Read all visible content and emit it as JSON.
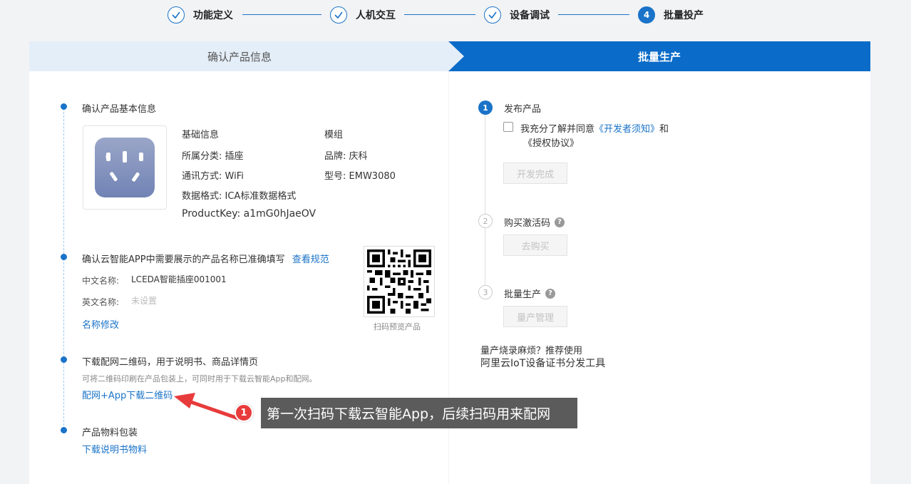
{
  "stepper": {
    "steps": [
      {
        "label": "功能定义",
        "state": "done"
      },
      {
        "label": "人机交互",
        "state": "done"
      },
      {
        "label": "设备调试",
        "state": "done"
      },
      {
        "label": "批量投产",
        "state": "active",
        "number": "4"
      }
    ]
  },
  "tabs": {
    "left": "确认产品信息",
    "right": "批量生产"
  },
  "left": {
    "section1": {
      "title": "确认产品基本信息",
      "basic_heading": "基础信息",
      "module_heading": "模组",
      "category": "所属分类: 插座",
      "comm": "通讯方式: WiFi",
      "data_format": "数据格式: ICA标准数据格式",
      "product_key": "ProductKey: a1mG0hJaeOV",
      "brand": "品牌: 庆科",
      "model": "型号: EMW3080"
    },
    "section2": {
      "title": "确认云智能APP中需要展示的产品名称已准确填写",
      "spec_link": "查看规范",
      "cn_label": "中文名称:",
      "cn_value": "LCEDA智能插座001001",
      "en_label": "英文名称:",
      "en_value": "未设置",
      "edit_link": "名称修改",
      "qr_caption": "扫码预览产品"
    },
    "section3": {
      "title": "下载配网二维码，用于说明书、商品详情页",
      "desc": "可将二维码印刷在产品包装上，可同时用于下载云智能App和配网。",
      "download_link": "配网+App下载二维码"
    },
    "section4": {
      "title": "产品物料包装",
      "download_link": "下载说明书物料"
    }
  },
  "right": {
    "step1": {
      "number": "1",
      "title": "发布产品",
      "agree_prefix": "我充分了解并同意",
      "dev_notice": "《开发者须知》",
      "and": "和",
      "license": "《授权协议》",
      "button": "开发完成"
    },
    "step2": {
      "number": "2",
      "title": "购买激活码",
      "button": "去购买"
    },
    "step3": {
      "number": "3",
      "title": "批量生产",
      "button": "量产管理"
    },
    "tip_text": "量产烧录麻烦？推荐使用",
    "tool_link": "阿里云IoT设备证书分发工具",
    "help_glyph": "?"
  },
  "annotation": {
    "number": "1",
    "text": "第一次扫码下载云智能App，后续扫码用来配网"
  },
  "colors": {
    "primary": "#1a73c8",
    "tab_active": "#0a6bc8",
    "annotation_red": "#e83b3b"
  }
}
